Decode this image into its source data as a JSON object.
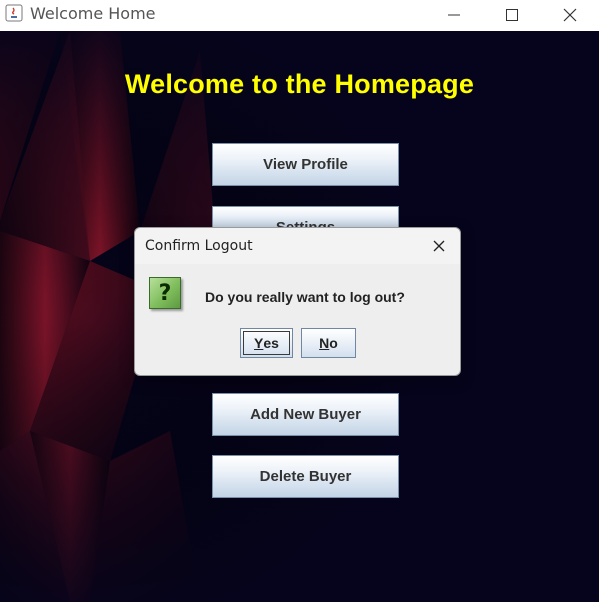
{
  "window": {
    "title": "Welcome Home"
  },
  "main": {
    "heading": "Welcome to the Homepage",
    "buttons": [
      {
        "label": "View Profile"
      },
      {
        "label": "Settings"
      },
      {
        "label": "Add New Buyer"
      },
      {
        "label": "Delete Buyer"
      }
    ]
  },
  "dialog": {
    "title": "Confirm Logout",
    "icon": "question-icon",
    "icon_glyph": "?",
    "message": "Do you really want to log out?",
    "yes": {
      "mnemonic": "Y",
      "rest": "es"
    },
    "no": {
      "mnemonic": "N",
      "rest": "o"
    }
  },
  "colors": {
    "heading": "#ffff00",
    "background": "#06041c",
    "accent_red": "#8a1428"
  }
}
